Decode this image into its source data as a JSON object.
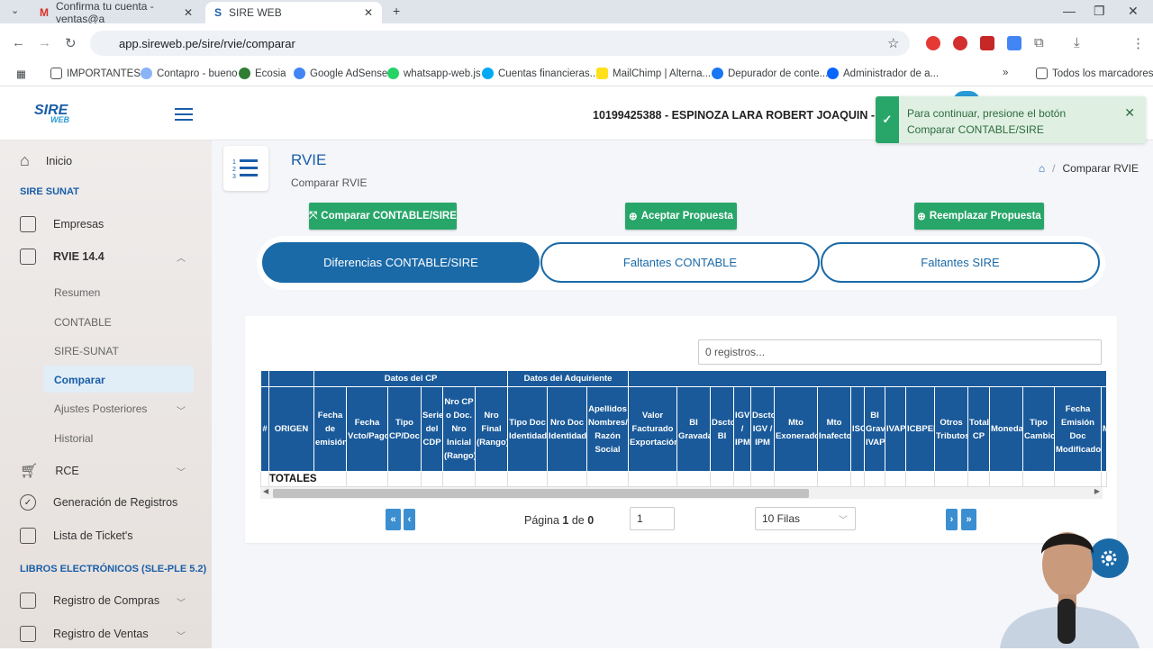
{
  "browser": {
    "tabs": [
      {
        "label": "Confirma tu cuenta - ventas@a"
      },
      {
        "label": "SIRE WEB"
      }
    ],
    "url": "app.sireweb.pe/sire/rvie/comparar",
    "bookmarks": [
      "IMPORTANTES",
      "Contapro - bueno",
      "Ecosia",
      "Google AdSense",
      "whatsapp-web.js",
      "Cuentas financieras...",
      "MailChimp | Alterna...",
      "Depurador de conte...",
      "Administrador de a..."
    ],
    "all_bookmarks": "Todos los marcadores"
  },
  "app": {
    "logo_main": "SIRE",
    "logo_sub": "WEB",
    "company": "10199425388 - ESPINOZA LARA ROBERT JOAQUIN - ENE"
  },
  "sidebar": {
    "inicio": "Inicio",
    "sec_sire": "SIRE SUNAT",
    "empresas": "Empresas",
    "rvie": "RVIE 14.4",
    "resumen": "Resumen",
    "contable": "CONTABLE",
    "siresunat": "SIRE-SUNAT",
    "comparar": "Comparar",
    "ajustes": "Ajustes Posteriores",
    "historial": "Historial",
    "rce": "RCE",
    "generacion": "Generación de Registros",
    "tickets": "Lista de Ticket's",
    "sec_libros": "LIBROS ELECTRÓNICOS (SLE-PLE 5.2)",
    "compras": "Registro de Compras",
    "ventas": "Registro de Ventas"
  },
  "page": {
    "title": "RVIE",
    "subtitle": "Comparar RVIE",
    "breadcrumb": "Comparar RVIE",
    "btn_comparar": "Comparar CONTABLE/SIRE",
    "btn_aceptar": "Aceptar Propuesta",
    "btn_reemplazar": "Reemplazar Propuesta",
    "tab_diferencias": "Diferencias CONTABLE/SIRE",
    "tab_faltantes_contable": "Faltantes CONTABLE",
    "tab_faltantes_sire": "Faltantes SIRE",
    "search_placeholder": "0 registros...",
    "group_cp": "Datos del CP",
    "group_adq": "Datos del Adquiriente",
    "columns": [
      "#",
      "ORIGEN",
      "Fecha de emisión",
      "Fecha Vcto/Pago",
      "Tipo CP/Doc",
      "Serie del CDP",
      "Nro CP o Doc. Nro Inicial (Rango)",
      "Nro Final (Rango)",
      "Tipo Doc Identidad",
      "Nro Doc Identidad",
      "Apellidos Nombres/ Razón Social",
      "Valor Facturado Exportación",
      "BI Gravada",
      "Dscto BI",
      "IGV / IPM",
      "Dscto IGV / IPM",
      "Mto Exonerado",
      "Mto Inafecto",
      "ISC",
      "BI Grav IVAP",
      "IVAP",
      "ICBPER",
      "Otros Tributos",
      "Total CP",
      "Moneda",
      "Tipo Cambio",
      "Fecha Emisión Doc Modificado",
      "M"
    ],
    "totals": "TOTALES",
    "pag_label_pre": "Página",
    "pag_current": "1",
    "pag_label_mid": "de",
    "pag_total": "0",
    "page_input": "1",
    "rows_select": "10 Filas"
  },
  "toast": {
    "line1": "Para continuar, presione el botón",
    "line2": "Comparar CONTABLE/SIRE"
  }
}
